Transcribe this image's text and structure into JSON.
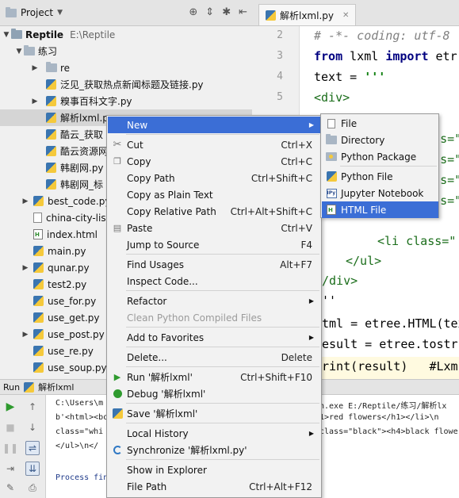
{
  "project_panel": {
    "title": "Project",
    "root": {
      "name": "Reptile",
      "path": "E:\\Reptile"
    },
    "items": [
      {
        "label": "练习"
      },
      {
        "label": "re"
      },
      {
        "label": "泛见_获取热点新闻标题及链接.py"
      },
      {
        "label": "糗事百科文字.py"
      },
      {
        "label": "解析lxml.py"
      },
      {
        "label": "酷云_获取"
      },
      {
        "label": "酷云资源网"
      },
      {
        "label": "韩剧网.py"
      },
      {
        "label": "韩剧网_标"
      },
      {
        "label": "best_code.py"
      },
      {
        "label": "china-city-list"
      },
      {
        "label": "index.html"
      },
      {
        "label": "main.py"
      },
      {
        "label": "qunar.py"
      },
      {
        "label": "test2.py"
      },
      {
        "label": "use_for.py"
      },
      {
        "label": "use_get.py"
      },
      {
        "label": "use_post.py"
      },
      {
        "label": "use_re.py"
      },
      {
        "label": "use_soup.py"
      }
    ]
  },
  "editor": {
    "tab_label": "解析lxml.py",
    "line_numbers": [
      "2",
      "3",
      "4",
      "5"
    ],
    "code_lines": [
      "# -*- coding: utf-8",
      "from lxml import etr",
      "text = '''",
      "<div>",
      "lass=\"",
      "lass=\"",
      "lass=\"",
      "lass=\"",
      "<li class=\"",
      "</ul>",
      "/div>",
      "''",
      "tml = etree.HTML(tex",
      "esult = etree.tostr",
      "rint(result)   #Lxm"
    ],
    "code_parts": {
      "from": "from",
      "lxml": " lxml ",
      "import": "import",
      "etr": " etr",
      "text": "text = ",
      "quote": "'''"
    }
  },
  "run_panel": {
    "label": "Run",
    "config": "解析lxml",
    "console_lines": [
      "C:\\Users\\m",
      "b'<html><bo",
      "class=\"whi",
      "</ul>\\n</",
      "Process fin"
    ],
    "console_right": [
      "n.exe E:/Reptile/练习/解析lx",
      "1>red flowers</h1></li>\\n",
      "class=\"black\"><h4>black flowe"
    ]
  },
  "context_menu": {
    "items": [
      {
        "label": "New",
        "shortcut": "",
        "submenu": true
      },
      {
        "label": "Cut",
        "shortcut": "Ctrl+X"
      },
      {
        "label": "Copy",
        "shortcut": "Ctrl+C"
      },
      {
        "label": "Copy Path",
        "shortcut": "Ctrl+Shift+C"
      },
      {
        "label": "Copy as Plain Text",
        "shortcut": ""
      },
      {
        "label": "Copy Relative Path",
        "shortcut": "Ctrl+Alt+Shift+C"
      },
      {
        "label": "Paste",
        "shortcut": "Ctrl+V"
      },
      {
        "label": "Jump to Source",
        "shortcut": "F4"
      },
      {
        "label": "Find Usages",
        "shortcut": "Alt+F7"
      },
      {
        "label": "Inspect Code...",
        "shortcut": ""
      },
      {
        "label": "Refactor",
        "shortcut": "",
        "submenu": true
      },
      {
        "label": "Clean Python Compiled Files",
        "shortcut": "",
        "disabled": true
      },
      {
        "label": "Add to Favorites",
        "shortcut": "",
        "submenu": true
      },
      {
        "label": "Delete...",
        "shortcut": "Delete"
      },
      {
        "label": "Run '解析lxml'",
        "shortcut": "Ctrl+Shift+F10"
      },
      {
        "label": "Debug '解析lxml'",
        "shortcut": ""
      },
      {
        "label": "Save '解析lxml'",
        "shortcut": ""
      },
      {
        "label": "Local History",
        "shortcut": "",
        "submenu": true
      },
      {
        "label": "Synchronize '解析lxml.py'",
        "shortcut": ""
      },
      {
        "label": "Show in Explorer",
        "shortcut": ""
      },
      {
        "label": "File Path",
        "shortcut": "Ctrl+Alt+F12"
      }
    ]
  },
  "new_submenu": {
    "items": [
      {
        "label": "File"
      },
      {
        "label": "Directory"
      },
      {
        "label": "Python Package"
      },
      {
        "label": "Python File"
      },
      {
        "label": "Jupyter Notebook"
      },
      {
        "label": "HTML File"
      }
    ]
  },
  "colors": {
    "selection": "#3b6ed6",
    "keyword": "#000080",
    "string": "#0a7d0a"
  }
}
